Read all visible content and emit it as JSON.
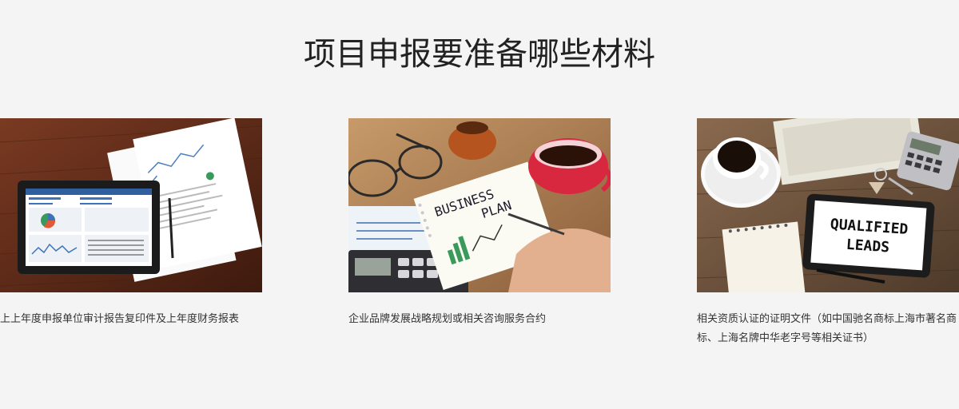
{
  "page_title": "项目申报要准备哪些材料",
  "cards": [
    {
      "caption": "上上年度申报单位审计报告复印件及上年度财务报表",
      "image_label": "tablet-with-reports"
    },
    {
      "caption": "企业品牌发展战略规划或相关咨询服务合约",
      "image_label": "business-plan-notebook",
      "image_text_1": "BUSINESS",
      "image_text_2": "PLAN"
    },
    {
      "caption": "相关资质认证的证明文件（如中国驰名商标上海市著名商标、上海名牌中华老字号等相关证书）",
      "image_label": "qualified-leads-tablet",
      "image_text_1": "QUALIFIED",
      "image_text_2": "LEADS"
    }
  ],
  "colors": {
    "background": "#f4f4f4",
    "title": "#222222",
    "caption": "#333333",
    "wood_dark": "#5a2f1e",
    "coffee_cup_red": "#d8283f"
  }
}
